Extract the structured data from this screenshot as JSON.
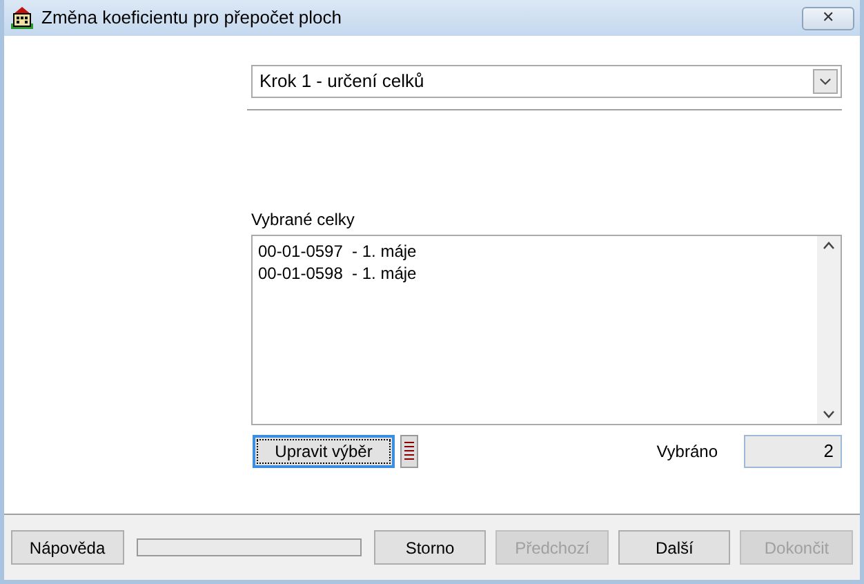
{
  "window": {
    "title": "Změna koeficientu pro přepočet ploch",
    "close": "✕"
  },
  "step": {
    "value": "Krok 1 - určení celků"
  },
  "selection": {
    "label": "Vybrané celky",
    "items": [
      {
        "text": "00-01-0597  - 1. máje"
      },
      {
        "text": "00-01-0598  - 1. máje"
      }
    ]
  },
  "edit_button": {
    "label": "Upravit výběr",
    "focused": true
  },
  "count": {
    "label": "Vybráno",
    "value": "2"
  },
  "buttons": [
    {
      "label": "Nápověda",
      "disabled": false
    },
    {
      "label": "Storno",
      "disabled": false
    },
    {
      "label": "Předchozí",
      "disabled": true
    },
    {
      "label": "Další",
      "disabled": false
    },
    {
      "label": "Dokončit",
      "disabled": true
    }
  ]
}
